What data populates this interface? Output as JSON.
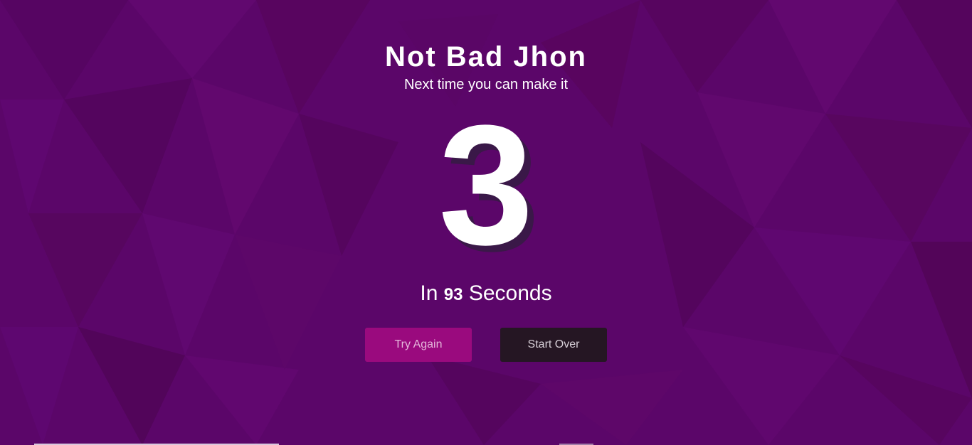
{
  "theme": {
    "background": "#5b0669",
    "try_again_color": "#9a0a7e",
    "start_over_color": "#251623",
    "text_color": "#ffffff"
  },
  "result": {
    "title": "Not Bad Jhon",
    "subtitle": "Next time you can make it",
    "score": "3",
    "time_prefix": "In",
    "time_value": "93",
    "time_suffix": "Seconds"
  },
  "actions": {
    "try_again_label": "Try Again",
    "start_over_label": "Start Over"
  }
}
